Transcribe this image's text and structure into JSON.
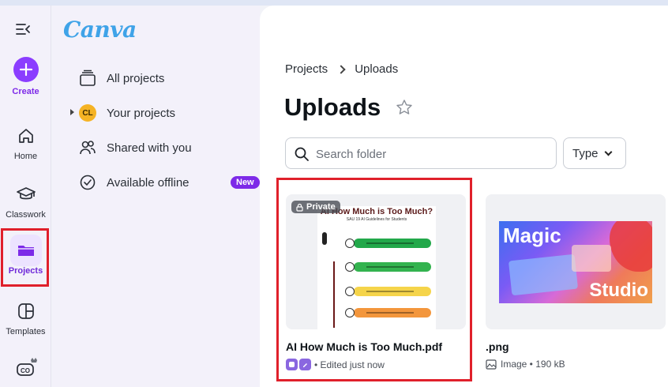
{
  "rail": {
    "create": "Create",
    "home": "Home",
    "classwork": "Classwork",
    "projects": "Projects",
    "templates": "Templates"
  },
  "panel": {
    "logo": "Canva",
    "all_projects": "All projects",
    "your_projects": "Your projects",
    "your_projects_avatar": "CL",
    "shared": "Shared with you",
    "offline": "Available offline",
    "offline_badge": "New"
  },
  "main": {
    "breadcrumb_root": "Projects",
    "breadcrumb_current": "Uploads",
    "title": "Uploads",
    "search_placeholder": "Search folder",
    "type_filter": "Type"
  },
  "cards": [
    {
      "name": "AI How Much is Too Much.pdf",
      "badge": "Private",
      "meta": "• Edited just now",
      "thumb_title": "AI How Much is Too Much?",
      "thumb_sub": "SAU 19 AI Guidelines for Students"
    },
    {
      "name": ".png",
      "meta": "Image • 190 kB",
      "thumb_word1": "Magic",
      "thumb_word2": "Studio"
    }
  ],
  "colors": {
    "accent": "#8b3dff",
    "highlight": "#e0202b",
    "avatar": "#f5b324"
  }
}
